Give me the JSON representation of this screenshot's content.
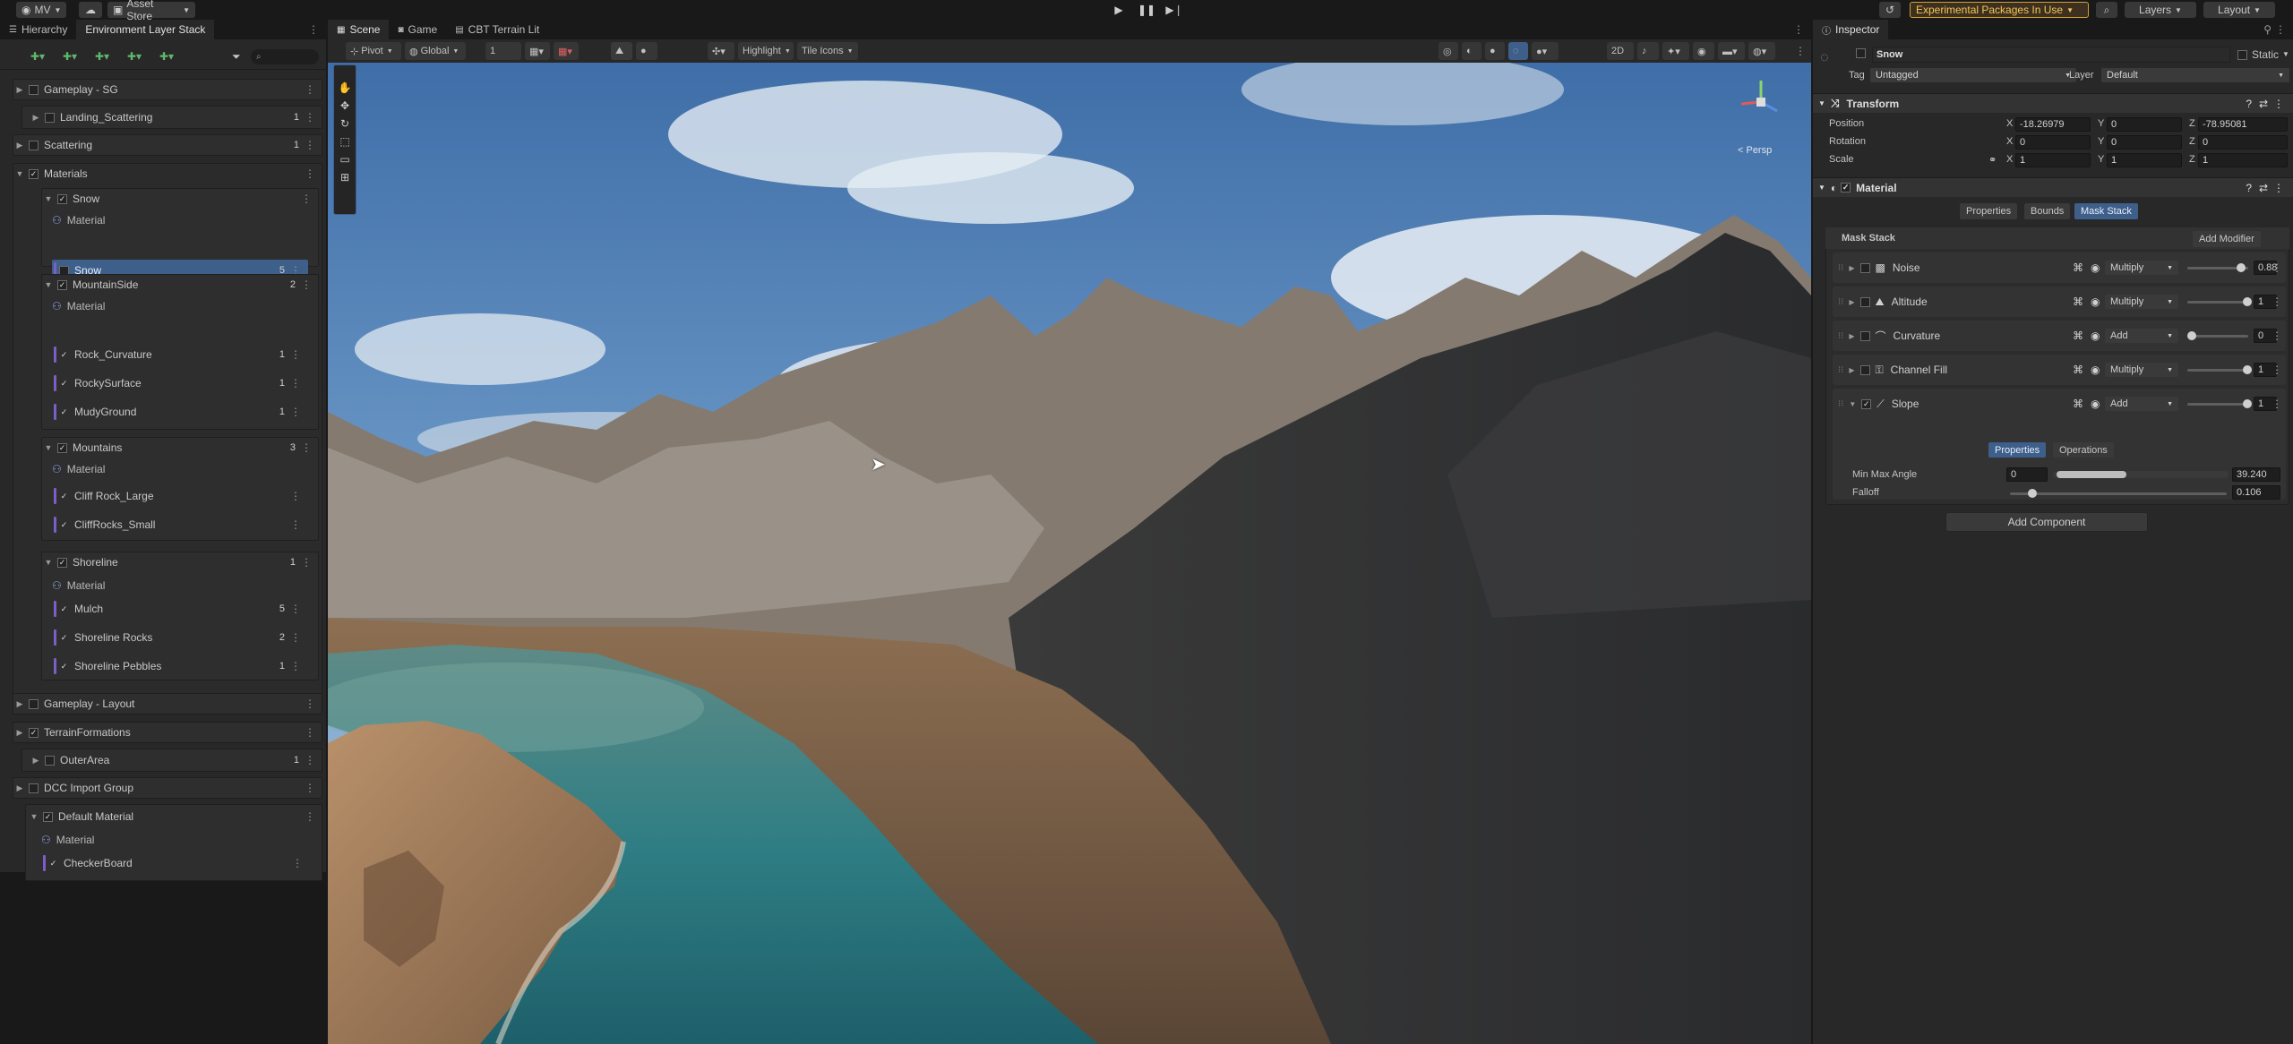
{
  "topbar": {
    "account": "MV",
    "cloud_icon": "cloud-icon",
    "asset_store": "Asset Store",
    "experimental": "Experimental Packages In Use",
    "layers": "Layers",
    "layout": "Layout"
  },
  "hierarchy": {
    "tabs": [
      "Hierarchy",
      "Environment Layer Stack"
    ],
    "search_placeholder": "",
    "rows": [
      {
        "label": "Gameplay - SG"
      },
      {
        "label": "Landing_Scattering",
        "count": "1"
      },
      {
        "label": "Scattering",
        "count": "1"
      },
      {
        "label": "Materials"
      },
      {
        "label": "Snow"
      },
      {
        "label": "Material"
      },
      {
        "label": "Snow",
        "count": "5"
      },
      {
        "label": "MountainSide",
        "count": "2"
      },
      {
        "label": "Material"
      },
      {
        "label": "Rock_Curvature",
        "count": "1"
      },
      {
        "label": "RockySurface",
        "count": "1"
      },
      {
        "label": "MudyGround",
        "count": "1"
      },
      {
        "label": "Mountains",
        "count": "3"
      },
      {
        "label": "Material"
      },
      {
        "label": "Cliff Rock_Large"
      },
      {
        "label": "CliffRocks_Small"
      },
      {
        "label": "Shoreline",
        "count": "1"
      },
      {
        "label": "Material"
      },
      {
        "label": "Mulch",
        "count": "5"
      },
      {
        "label": "Shoreline Rocks",
        "count": "2"
      },
      {
        "label": "Shoreline Pebbles",
        "count": "1"
      },
      {
        "label": "Gameplay - Layout"
      },
      {
        "label": "TerrainFormations"
      },
      {
        "label": "OuterArea",
        "count": "1"
      },
      {
        "label": "DCC Import Group"
      },
      {
        "label": "Default Material"
      },
      {
        "label": "Material"
      },
      {
        "label": "CheckerBoard"
      }
    ]
  },
  "scene": {
    "tabs": [
      "Scene",
      "Game",
      "CBT Terrain Lit"
    ],
    "pivot": "Pivot",
    "global": "Global",
    "grid_value": "1",
    "highlight": "Highlight",
    "tile_icons": "Tile Icons",
    "mode_2d": "2D",
    "persp": "< Persp"
  },
  "inspector": {
    "tab": "Inspector",
    "object_name": "Snow",
    "static_label": "Static",
    "tag_label": "Tag",
    "tag_value": "Untagged",
    "layer_label": "Layer",
    "layer_value": "Default",
    "transform": {
      "title": "Transform",
      "position_label": "Position",
      "rotation_label": "Rotation",
      "scale_label": "Scale",
      "position": [
        "-18.26979",
        "0",
        "-78.95081"
      ],
      "rotation": [
        "0",
        "0",
        "0"
      ],
      "scale": [
        "1",
        "1",
        "1"
      ],
      "axes": [
        "X",
        "Y",
        "Z"
      ]
    },
    "material": {
      "title": "Material",
      "tabs": [
        "Properties",
        "Bounds",
        "Mask Stack"
      ],
      "mask_stack_label": "Mask Stack",
      "add_modifier": "Add Modifier",
      "modifiers": [
        {
          "name": "Noise",
          "blend": "Multiply",
          "value": "0.88",
          "level": 0.88
        },
        {
          "name": "Altitude",
          "blend": "Multiply",
          "value": "1",
          "level": 1
        },
        {
          "name": "Curvature",
          "blend": "Add",
          "value": "0",
          "level": 0
        },
        {
          "name": "Channel Fill",
          "blend": "Multiply",
          "value": "1",
          "level": 1
        },
        {
          "name": "Slope",
          "blend": "Add",
          "value": "1",
          "level": 1
        }
      ],
      "slope_tabs": [
        "Properties",
        "Operations"
      ],
      "min_max_label": "Min Max Angle",
      "min_value": "0",
      "max_value": "39.240",
      "falloff_label": "Falloff",
      "falloff_value": "0.106"
    },
    "add_component": "Add Component"
  }
}
